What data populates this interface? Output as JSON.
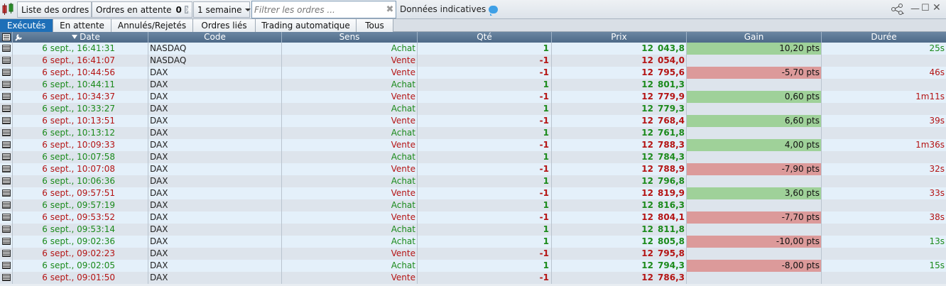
{
  "toolbar": {
    "title": "Liste des ordres",
    "pending_label": "Ordres en attente",
    "pending_count": "0",
    "period": "1 semaine",
    "filter_placeholder": "Filtrer les ordres ...",
    "indicative": "Données indicatives"
  },
  "tabs": [
    "Exécutés",
    "En attente",
    "Annulés/Rejetés",
    "Ordres liés",
    "Trading automatique",
    "Tous"
  ],
  "columns": {
    "date": "Date",
    "code": "Code",
    "sens": "Sens",
    "qte": "Qté",
    "prix": "Prix",
    "gain": "Gain",
    "duree": "Durée"
  },
  "rows": [
    {
      "date": "6 sept., 16:41:31",
      "code": "NASDAQ",
      "sens": "Achat",
      "qte": "1",
      "prix_a": "12",
      "prix_b": "043,8",
      "gain": "10,20 pts",
      "gain_type": "pos",
      "duree": "25s"
    },
    {
      "date": "6 sept., 16:41:07",
      "code": "NASDAQ",
      "sens": "Vente",
      "qte": "-1",
      "prix_a": "12",
      "prix_b": "054,0",
      "gain": "",
      "gain_type": "",
      "duree": ""
    },
    {
      "date": "6 sept., 10:44:56",
      "code": "DAX",
      "sens": "Vente",
      "qte": "-1",
      "prix_a": "12",
      "prix_b": "795,6",
      "gain": "-5,70 pts",
      "gain_type": "neg",
      "duree": "46s"
    },
    {
      "date": "6 sept., 10:44:11",
      "code": "DAX",
      "sens": "Achat",
      "qte": "1",
      "prix_a": "12",
      "prix_b": "801,3",
      "gain": "",
      "gain_type": "",
      "duree": ""
    },
    {
      "date": "6 sept., 10:34:37",
      "code": "DAX",
      "sens": "Vente",
      "qte": "-1",
      "prix_a": "12",
      "prix_b": "779,9",
      "gain": "0,60 pts",
      "gain_type": "pos",
      "duree": "1m11s"
    },
    {
      "date": "6 sept., 10:33:27",
      "code": "DAX",
      "sens": "Achat",
      "qte": "1",
      "prix_a": "12",
      "prix_b": "779,3",
      "gain": "",
      "gain_type": "",
      "duree": ""
    },
    {
      "date": "6 sept., 10:13:51",
      "code": "DAX",
      "sens": "Vente",
      "qte": "-1",
      "prix_a": "12",
      "prix_b": "768,4",
      "gain": "6,60 pts",
      "gain_type": "pos",
      "duree": "39s"
    },
    {
      "date": "6 sept., 10:13:12",
      "code": "DAX",
      "sens": "Achat",
      "qte": "1",
      "prix_a": "12",
      "prix_b": "761,8",
      "gain": "",
      "gain_type": "",
      "duree": ""
    },
    {
      "date": "6 sept., 10:09:33",
      "code": "DAX",
      "sens": "Vente",
      "qte": "-1",
      "prix_a": "12",
      "prix_b": "788,3",
      "gain": "4,00 pts",
      "gain_type": "pos",
      "duree": "1m36s"
    },
    {
      "date": "6 sept., 10:07:58",
      "code": "DAX",
      "sens": "Achat",
      "qte": "1",
      "prix_a": "12",
      "prix_b": "784,3",
      "gain": "",
      "gain_type": "",
      "duree": ""
    },
    {
      "date": "6 sept., 10:07:08",
      "code": "DAX",
      "sens": "Vente",
      "qte": "-1",
      "prix_a": "12",
      "prix_b": "788,9",
      "gain": "-7,90 pts",
      "gain_type": "neg",
      "duree": "32s"
    },
    {
      "date": "6 sept., 10:06:36",
      "code": "DAX",
      "sens": "Achat",
      "qte": "1",
      "prix_a": "12",
      "prix_b": "796,8",
      "gain": "",
      "gain_type": "",
      "duree": ""
    },
    {
      "date": "6 sept., 09:57:51",
      "code": "DAX",
      "sens": "Vente",
      "qte": "-1",
      "prix_a": "12",
      "prix_b": "819,9",
      "gain": "3,60 pts",
      "gain_type": "pos",
      "duree": "33s"
    },
    {
      "date": "6 sept., 09:57:19",
      "code": "DAX",
      "sens": "Achat",
      "qte": "1",
      "prix_a": "12",
      "prix_b": "816,3",
      "gain": "",
      "gain_type": "",
      "duree": ""
    },
    {
      "date": "6 sept., 09:53:52",
      "code": "DAX",
      "sens": "Vente",
      "qte": "-1",
      "prix_a": "12",
      "prix_b": "804,1",
      "gain": "-7,70 pts",
      "gain_type": "neg",
      "duree": "38s"
    },
    {
      "date": "6 sept., 09:53:14",
      "code": "DAX",
      "sens": "Achat",
      "qte": "1",
      "prix_a": "12",
      "prix_b": "811,8",
      "gain": "",
      "gain_type": "",
      "duree": ""
    },
    {
      "date": "6 sept., 09:02:36",
      "code": "DAX",
      "sens": "Achat",
      "qte": "1",
      "prix_a": "12",
      "prix_b": "805,8",
      "gain": "-10,00 pts",
      "gain_type": "neg",
      "duree": "13s"
    },
    {
      "date": "6 sept., 09:02:23",
      "code": "DAX",
      "sens": "Vente",
      "qte": "-1",
      "prix_a": "12",
      "prix_b": "795,8",
      "gain": "",
      "gain_type": "",
      "duree": ""
    },
    {
      "date": "6 sept., 09:02:05",
      "code": "DAX",
      "sens": "Achat",
      "qte": "1",
      "prix_a": "12",
      "prix_b": "794,3",
      "gain": "-8,00 pts",
      "gain_type": "neg",
      "duree": "15s"
    },
    {
      "date": "6 sept., 09:01:50",
      "code": "DAX",
      "sens": "Vente",
      "qte": "-1",
      "prix_a": "12",
      "prix_b": "786,3",
      "gain": "",
      "gain_type": "",
      "duree": ""
    }
  ]
}
